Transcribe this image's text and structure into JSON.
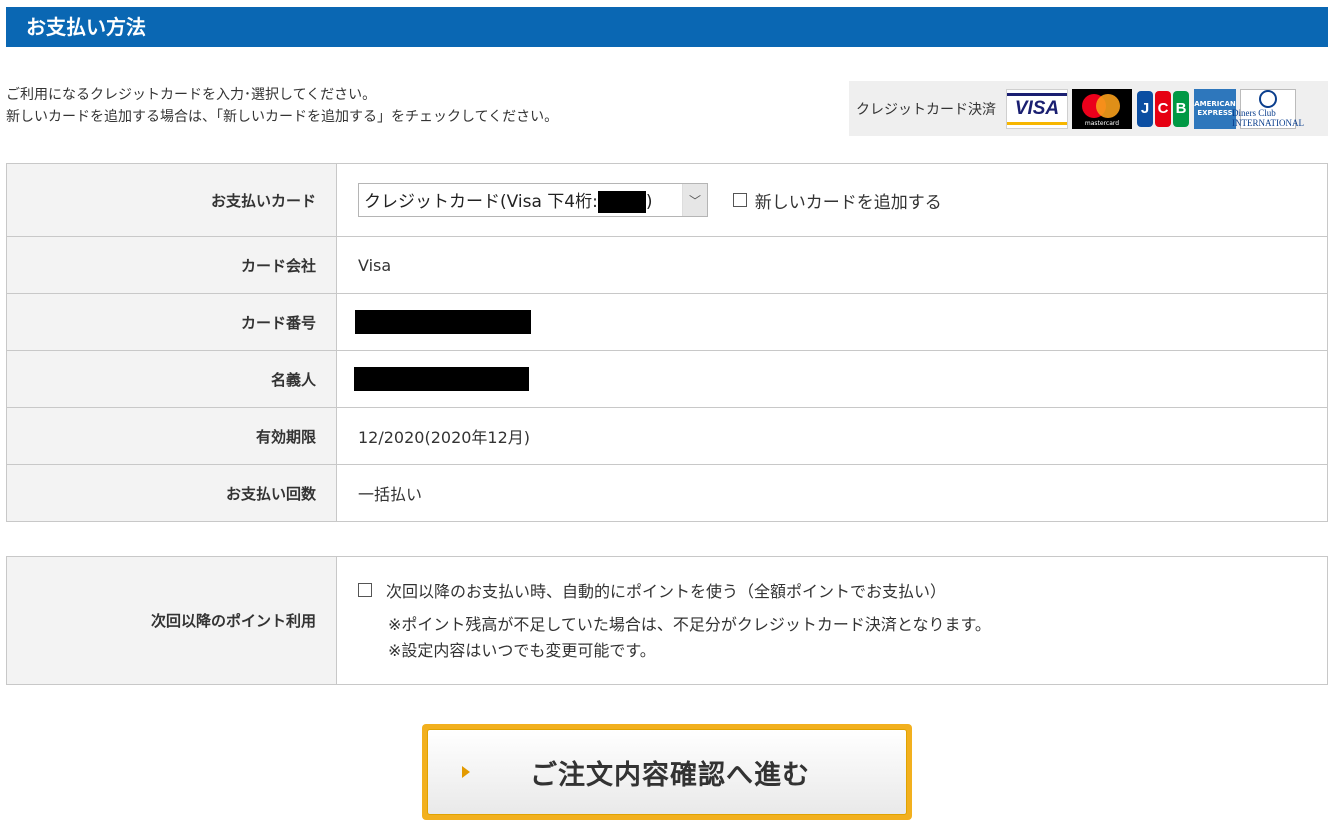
{
  "header": {
    "title": "お支払い方法"
  },
  "intro": {
    "line1": "ご利用になるクレジットカードを入力･選択してください。",
    "line2": "新しいカードを追加する場合は、「新しいカードを追加する」をチェックしてください。"
  },
  "brands": {
    "label": "クレジットカード決済",
    "logos": [
      "VISA",
      "mastercard",
      "JCB",
      "AMERICAN EXPRESS",
      "Diners Club INTERNATIONAL"
    ]
  },
  "payment_table": {
    "card_select": {
      "label": "お支払いカード",
      "value_prefix": "クレジットカード(Visa 下4桁:",
      "value_suffix": ")",
      "arrow": "﹀"
    },
    "new_card": {
      "label": "新しいカードを追加する",
      "checked": false
    },
    "card_company": {
      "label": "カード会社",
      "value": "Visa"
    },
    "card_number": {
      "label": "カード番号"
    },
    "holder": {
      "label": "名義人"
    },
    "expiry": {
      "label": "有効期限",
      "value": "12/2020(2020年12月)"
    },
    "installments": {
      "label": "お支払い回数",
      "value": "一括払い"
    }
  },
  "points": {
    "label": "次回以降のポイント利用",
    "checkbox_label": "次回以降のお支払い時、自動的にポイントを使う（全額ポイントでお支払い）",
    "checked": false,
    "note1": "※ポイント残高が不足していた場合は、不足分がクレジットカード決済となります。",
    "note2": "※設定内容はいつでも変更可能です。"
  },
  "submit": {
    "label": "ご注文内容確認へ進む"
  },
  "colors": {
    "header_bg": "#0a67b3",
    "button_border": "#f2b01e",
    "arrow": "#e39a00"
  }
}
